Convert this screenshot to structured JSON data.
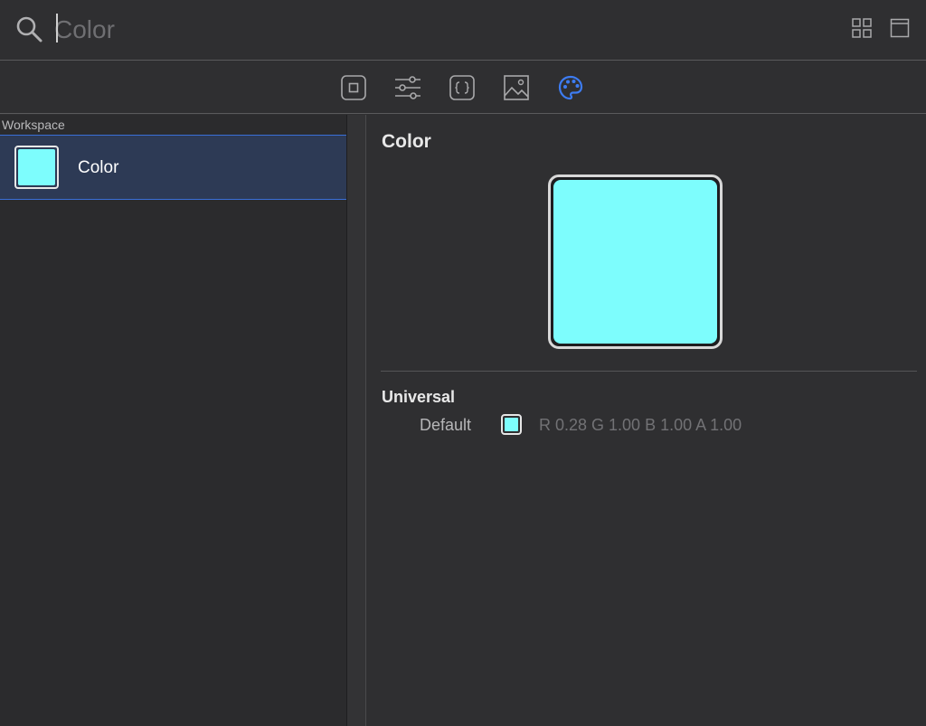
{
  "search": {
    "placeholder": "Color",
    "value": ""
  },
  "toolbar": {
    "right_icons": [
      "grid-icon",
      "window-icon"
    ]
  },
  "tabs": [
    {
      "icon": "square-object-icon",
      "active": false
    },
    {
      "icon": "sliders-icon",
      "active": false
    },
    {
      "icon": "braces-icon",
      "active": false
    },
    {
      "icon": "image-icon",
      "active": false
    },
    {
      "icon": "palette-icon",
      "active": true
    }
  ],
  "colors": {
    "accent": "#3d7cf2",
    "icon_gray": "#a9a9ab",
    "selected_color": "#7dfdfd"
  },
  "library": {
    "section": "Workspace",
    "items": [
      {
        "label": "Color",
        "selected": true
      }
    ]
  },
  "detail": {
    "title": "Color",
    "appearance": "Universal",
    "variants": [
      {
        "label": "Default",
        "value": "R 0.28 G 1.00 B 1.00 A 1.00"
      }
    ]
  }
}
